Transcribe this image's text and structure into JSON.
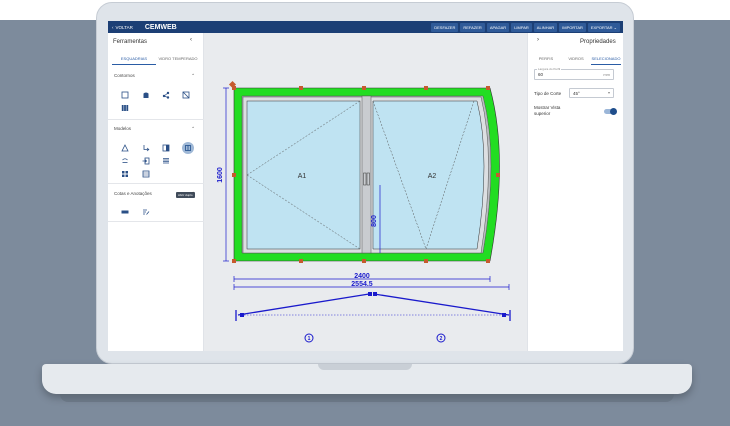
{
  "app": {
    "back_label": "VOLTAR",
    "brand": "CEMWEB"
  },
  "toolbar": {
    "buttons": [
      "DESFAZER",
      "REFAZER",
      "APAGAR",
      "LIMPAR",
      "ALINHAR",
      "IMPORTAR",
      "EXPORTAR ⌄"
    ]
  },
  "left_panel": {
    "title": "Ferramentas",
    "tabs": [
      "ESQUADRIAS",
      "VIDRO TEMPERADO"
    ],
    "sections": {
      "contornos": "Contornos",
      "modelos": "Modelos",
      "cotas": "Cotas e Anotações"
    },
    "tooltip": "Abrir duplo"
  },
  "drawing": {
    "panel_a1": "A1",
    "panel_a2": "A2",
    "dim_height": "1600",
    "dim_width": "2400",
    "dim_total": "2554.5",
    "dim_handle": "800",
    "marker_1": "1",
    "marker_2": "2",
    "colors": {
      "frame": "#22dd22",
      "glass": "#bfe3f2",
      "dimension": "#1a1acc",
      "corner": "#c65a2e"
    }
  },
  "right_panel": {
    "title": "Propriedades",
    "tabs": [
      "PERFIS",
      "VIDROS",
      "SELECIONADO"
    ],
    "profile_width_label": "Largura do Perfil",
    "profile_width_value": "60",
    "profile_width_unit": "mm",
    "cut_type_label": "Tipo de Corte",
    "cut_type_value": "45°",
    "show_top_view_label": "Mostrar Vista superior"
  }
}
